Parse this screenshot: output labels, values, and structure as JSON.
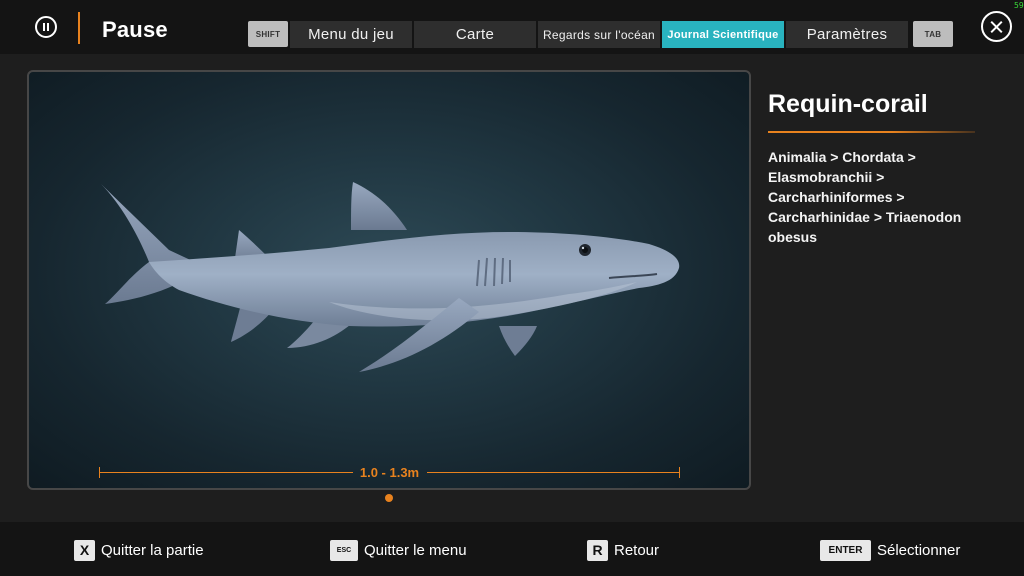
{
  "header": {
    "title": "Pause",
    "tabs": [
      {
        "label": "Menu du jeu",
        "active": false
      },
      {
        "label": "Carte",
        "active": false
      },
      {
        "label": "Regards sur l'océan",
        "active": false
      },
      {
        "label": "Journal Scientifique",
        "active": true
      },
      {
        "label": "Paramètres",
        "active": false
      }
    ],
    "prev_key": "SHIFT",
    "next_key": "TAB",
    "fps": "59"
  },
  "entry": {
    "name": "Requin-corail",
    "taxonomy": "Animalia > Chordata > Elasmobranchii > Carcharhiniformes > Carcharhinidae > Triaenodon obesus",
    "size_range": "1.0 - 1.3m"
  },
  "footer": {
    "actions": [
      {
        "key": "X",
        "label": "Quitter la partie"
      },
      {
        "key": "ESC",
        "label": "Quitter le menu"
      },
      {
        "key": "R",
        "label": "Retour"
      },
      {
        "key": "ENTER",
        "label": "Sélectionner"
      }
    ]
  },
  "colors": {
    "accent": "#e8821e",
    "active_tab": "#29b3bf",
    "background": "#1e1e1e",
    "bar": "#141414"
  },
  "icons": {
    "pause": "pause-icon",
    "close": "close-icon"
  }
}
